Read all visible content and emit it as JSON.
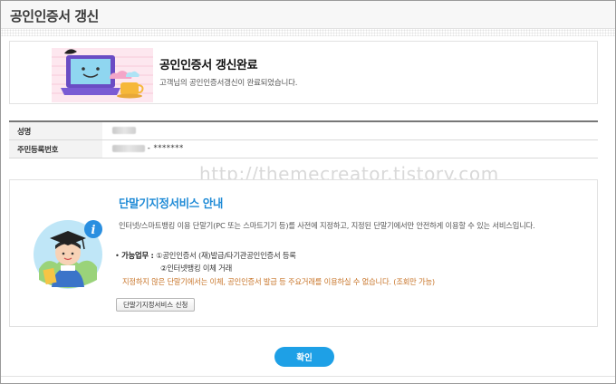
{
  "header": {
    "title": "공인인증서 갱신"
  },
  "complete": {
    "title": "공인인증서 갱신완료",
    "description": "고객님의 공인인증서갱신이 완료되었습니다."
  },
  "info": {
    "name_label": "성명",
    "rrn_label": "주민등록번호",
    "rrn_masked": "- *******"
  },
  "watermark": "http://themecreator.tistory.com",
  "service": {
    "title": "단말기지정서비스 안내",
    "description": "인터넷/스마트뱅킹 이용 단말기(PC 또는 스마트기기 등)를 사전에 지정하고, 지정된 단말기에서만 안전하게 이용할 수 있는 서비스입니다.",
    "tasks_label": "가능업무 :",
    "task1": "①공인인증서 (재)발급/타기관공인인증서 등록",
    "task2": "②인터넷뱅킹 이체 거래",
    "warning": "지정하지 않은 단말기에서는 이체, 공인인증서 발급 등 주요거래를 이용하실 수 없습니다. (조회만 가능)",
    "apply_button": "단말기지정서비스 신청"
  },
  "confirm_button": "확인",
  "colors": {
    "accent": "#1ea0e6",
    "title_blue": "#1e8ad6",
    "warning": "#c8752a"
  }
}
